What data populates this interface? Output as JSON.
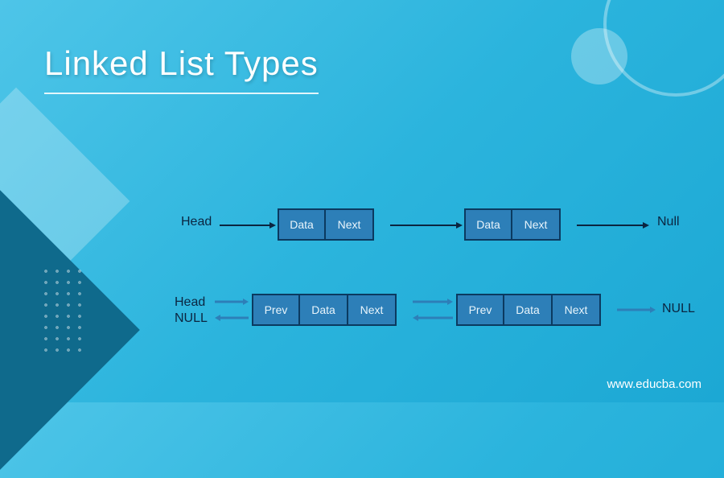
{
  "title": "Linked List Types",
  "footer": "www.educba.com",
  "singly": {
    "head": "Head",
    "null": "Null",
    "node": {
      "data": "Data",
      "next": "Next"
    }
  },
  "doubly": {
    "head": "Head",
    "null_left": "NULL",
    "null_right": "NULL",
    "node": {
      "prev": "Prev",
      "data": "Data",
      "next": "Next"
    }
  }
}
